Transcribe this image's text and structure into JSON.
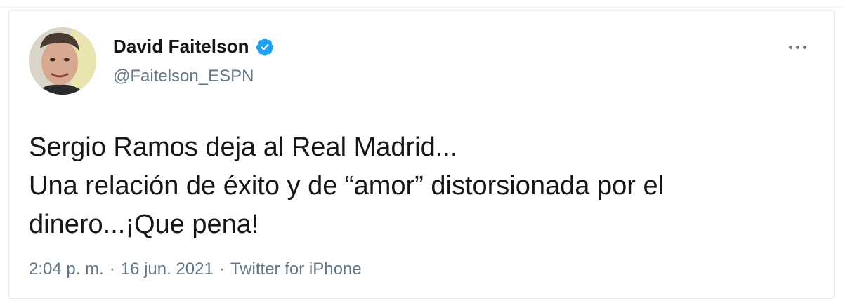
{
  "tweet": {
    "author": {
      "display_name": "David Faitelson",
      "handle": "@Faitelson_ESPN",
      "verified": true
    },
    "text_lines": [
      "Sergio Ramos deja al Real Madrid...",
      "Una relación de éxito y de “amor” distorsionada por el",
      "dinero...¡Que pena!"
    ],
    "time": "2:04 p. m.",
    "separator": "·",
    "date": "16 jun. 2021",
    "source": "Twitter for iPhone"
  },
  "icons": {
    "verified": "verified-badge-icon",
    "more": "more-options-icon"
  },
  "colors": {
    "verified_blue": "#1da1f2",
    "primary_text": "#14171a",
    "secondary_text": "#657786"
  }
}
